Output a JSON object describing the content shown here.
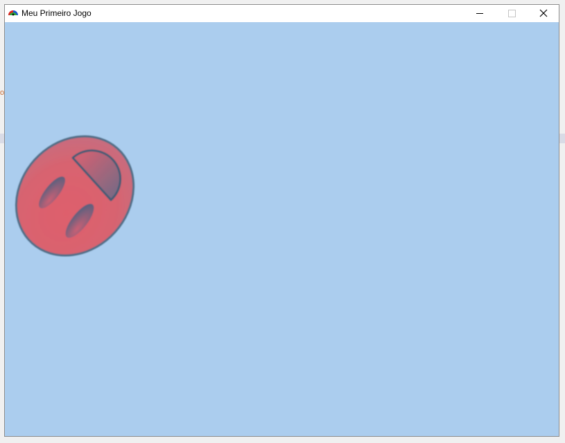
{
  "window": {
    "title": "Meu Primeiro Jogo",
    "buttons": {
      "minimize": "minimize-icon",
      "maximize": "maximize-icon",
      "close": "close-icon"
    }
  },
  "background_app": {
    "partial_char": "o"
  },
  "game": {
    "background_color": "#abcdee",
    "sprite": {
      "icon": "red-face-icon",
      "body_color": "#d9616e",
      "outline_color": "#4f6d86"
    }
  }
}
